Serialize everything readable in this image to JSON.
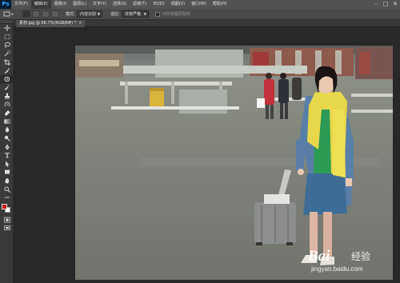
{
  "app": {
    "logo": "Ps"
  },
  "menubar": {
    "items": [
      "文件(F)",
      "编辑(E)",
      "图像(I)",
      "图层(L)",
      "文字(Y)",
      "选择(S)",
      "滤镜(T)",
      "3D(D)",
      "视图(V)",
      "窗口(W)",
      "帮助(H)"
    ],
    "active_index": 1
  },
  "window_controls": {
    "minimize": "–",
    "maximize": "□",
    "close": "✕"
  },
  "options_bar": {
    "mode_label": "模式:",
    "mode_value": "内容识别",
    "adapt_label": "适应:",
    "adapt_value": "非常严格",
    "sample_all_layers_label": "对所有图层取样"
  },
  "document": {
    "tab_title": "素材.jpg @ 66.7%(RGB/8#) *",
    "close_icon": "×"
  },
  "tools": [
    "move-icon",
    "marquee-icon",
    "lasso-icon",
    "quick-select-icon",
    "crop-icon",
    "eyedropper-icon",
    "patch-icon",
    "brush-icon",
    "clone-stamp-icon",
    "history-brush-icon",
    "eraser-icon",
    "gradient-icon",
    "blur-icon",
    "dodge-icon",
    "pen-icon",
    "type-icon",
    "path-select-icon",
    "shape-icon",
    "hand-icon",
    "zoom-icon"
  ],
  "colors": {
    "foreground": "#cc1111",
    "background": "#ffffff",
    "ui_panel": "#3a3a3a",
    "menubar": "#535353"
  },
  "watermark": {
    "brand_text": "Bai",
    "brand_cn": "经验",
    "url": "jingyan.baidu.com"
  }
}
